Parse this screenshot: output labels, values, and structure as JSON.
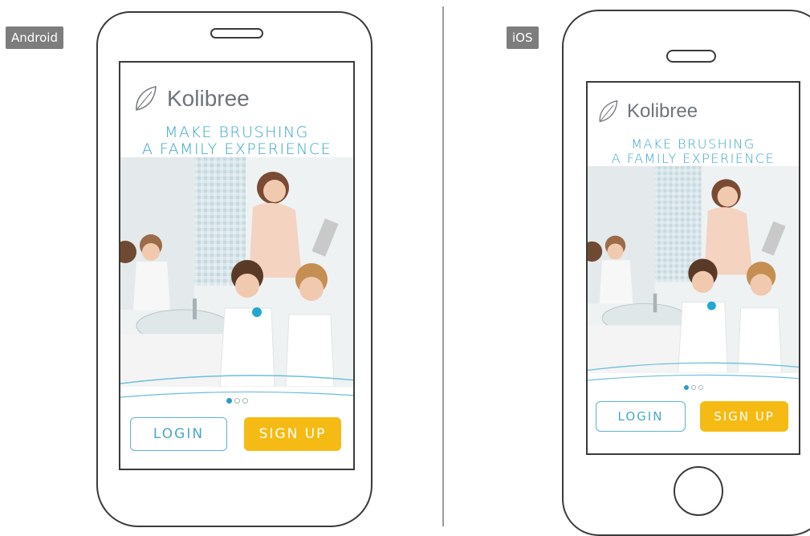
{
  "android": {
    "platform_label": "Android",
    "app": {
      "brand": "Kolibree",
      "headline_line1": "MAKE BRUSHING",
      "headline_line2": "A FAMILY EXPERIENCE",
      "login_label": "LOGIN",
      "signup_label": "SIGN UP",
      "pager": {
        "total": 3,
        "active": 1
      }
    }
  },
  "ios": {
    "platform_label": "iOS",
    "app": {
      "brand": "Kolibree",
      "headline_line1": "MAKE BRUSHING",
      "headline_line2": "A FAMILY EXPERIENCE",
      "login_label": "LOGIN",
      "signup_label": "SIGN UP",
      "pager": {
        "total": 3,
        "active": 1
      }
    }
  },
  "colors": {
    "accent_blue": "#3aa6c9",
    "signup_yellow": "#f5bb14",
    "outline": "#3a3a3a",
    "label_gray": "#7d7d7d"
  },
  "icons": {
    "logo": "leaf-icon"
  }
}
